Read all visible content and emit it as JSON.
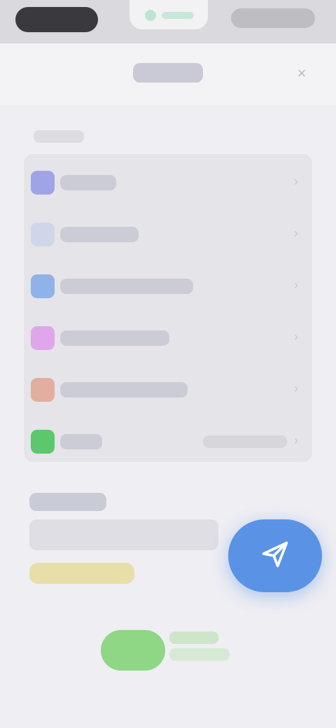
{
  "status_bar": {
    "time": "",
    "indicator": "",
    "right": ""
  },
  "nav": {
    "title": "",
    "close_icon": "close-icon"
  },
  "settings": {
    "section_label": "",
    "rows": [
      {
        "label": "",
        "icon": "row-icon",
        "color": "#9ea4e6"
      },
      {
        "label": "",
        "icon": "row-icon",
        "color": "#cfd6ea"
      },
      {
        "label": "",
        "icon": "row-icon",
        "color": "#8fb2e8"
      },
      {
        "label": "",
        "icon": "row-icon",
        "color": "#dfa7e9"
      },
      {
        "label": "",
        "icon": "row-icon",
        "color": "#e3ada0"
      },
      {
        "label": "",
        "icon": "row-icon",
        "color": "#5cc76b",
        "value": ""
      }
    ]
  },
  "notice": {
    "title": "",
    "body": "",
    "highlight": "",
    "highlight_color": "#e8dfa8"
  },
  "fab": {
    "label": "",
    "color": "#5a93e6",
    "icon": "send-icon"
  },
  "brand": {
    "name": "",
    "subtitle": "",
    "color": "#8fd685"
  }
}
